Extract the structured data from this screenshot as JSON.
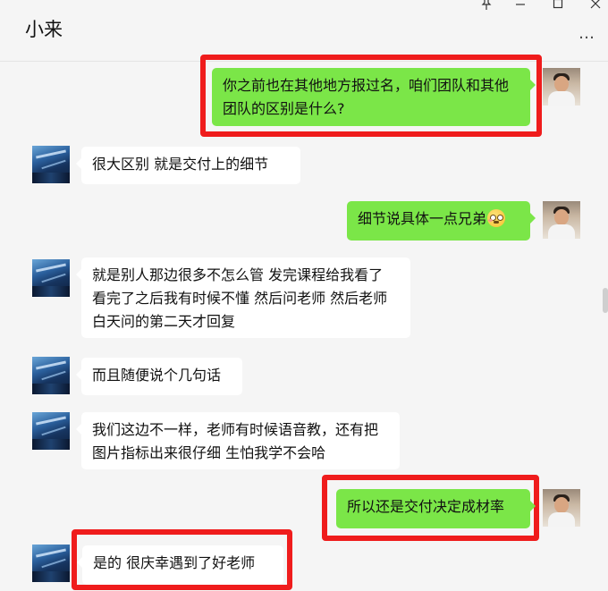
{
  "window": {
    "title": "小来",
    "pin_icon": "pin-icon",
    "minimize_icon": "minimize-icon",
    "maximize_icon": "maximize-icon",
    "close_icon": "close-icon",
    "more_icon": "more-icon",
    "more_glyph": "…"
  },
  "messages": [
    {
      "from": "me",
      "text": "你之前也在其他地方报过名，咱们团队和其他团队的区别是什么?",
      "highlighted": true
    },
    {
      "from": "contact",
      "text": "很大区别  就是交付上的细节"
    },
    {
      "from": "me",
      "text": "细节说具体一点兄弟",
      "emoji": "blush-emoji"
    },
    {
      "from": "contact",
      "text": "就是别人那边很多不怎么管  发完课程给我看了  看完了之后我有时候不懂  然后问老师 然后老师白天问的第二天才回复"
    },
    {
      "from": "contact",
      "text": "而且随便说个几句话"
    },
    {
      "from": "contact",
      "text": "我们这边不一样，老师有时候语音教，还有把图片指标出来很仔细  生怕我学不会哈"
    },
    {
      "from": "me",
      "text": "所以还是交付决定成材率",
      "highlighted": true
    },
    {
      "from": "contact",
      "text": "是的  很庆幸遇到了好老师",
      "highlighted": true
    }
  ],
  "colors": {
    "outgoing_bubble": "#7be648",
    "incoming_bubble": "#ffffff",
    "highlight_border": "#ef1c1c",
    "background": "#f5f5f5"
  }
}
